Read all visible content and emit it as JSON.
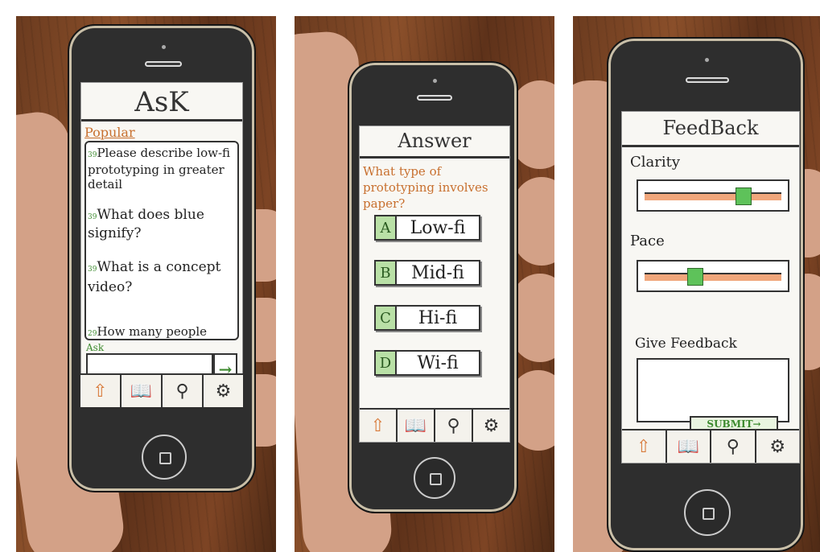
{
  "panels": {
    "ask": {
      "title": "AsK",
      "section_label": "Popular",
      "questions": [
        {
          "votes": "39",
          "text": "Please describe low-fi prototyping in greater detail"
        },
        {
          "votes": "39",
          "text": "What does blue signify?"
        },
        {
          "votes": "39",
          "text": "What is a concept video?"
        },
        {
          "votes": "29",
          "text": "How many people"
        }
      ],
      "ask_label": "Ask",
      "send_icon": "arrow-right-icon"
    },
    "answer": {
      "title": "Answer",
      "question": "What type of prototyping involves paper?",
      "options": [
        {
          "letter": "A",
          "text": "Low-fi"
        },
        {
          "letter": "B",
          "text": "Mid-fi"
        },
        {
          "letter": "C",
          "text": "Hi-fi"
        },
        {
          "letter": "D",
          "text": "Wi-fi"
        }
      ]
    },
    "feedback": {
      "title": "FeedBack",
      "clarity_label": "Clarity",
      "clarity_value": 0.75,
      "pace_label": "Pace",
      "pace_value": 0.35,
      "give_feedback_label": "Give Feedback",
      "submit_label": "SUBMIT→"
    }
  },
  "tabbar_icons": [
    "home-icon",
    "book-icon",
    "search-icon",
    "gear-icon"
  ],
  "colors": {
    "accent_orange": "#d87a3a",
    "accent_green": "#5ec25a"
  }
}
